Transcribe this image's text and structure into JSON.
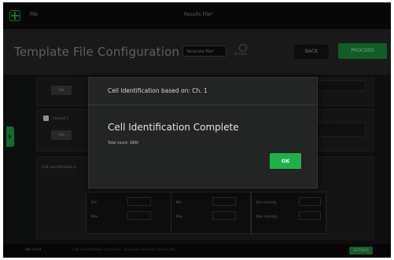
{
  "window": {
    "file_menu": "File",
    "title": "Results File*"
  },
  "header": {
    "page_title": "Template File Configuration",
    "template_input_value": "Template File*",
    "browse_label": "Browse",
    "back_label": "BACK",
    "proceed_label": "PROCEED"
  },
  "content": {
    "channel_label": "Channel 1",
    "section_label": "Cell identification p",
    "button_label": "Edit",
    "params": [
      "Min",
      "Max",
      "Min",
      "Max",
      "Min intensity",
      "Max intensity"
    ]
  },
  "footer": {
    "version": "Ver 4.0.0",
    "status": "Cell identification complete. Template saved to results file.",
    "badge": "SETTINGS"
  },
  "modal": {
    "title": "Cell Identification based on: Ch. 1",
    "heading": "Cell Identification Complete",
    "count_text": "Total count: 3000",
    "ok_label": "OK"
  },
  "colors": {
    "accent": "#20b04a",
    "background": "#0e0f10",
    "header": "#272727",
    "modal": "#232424"
  }
}
